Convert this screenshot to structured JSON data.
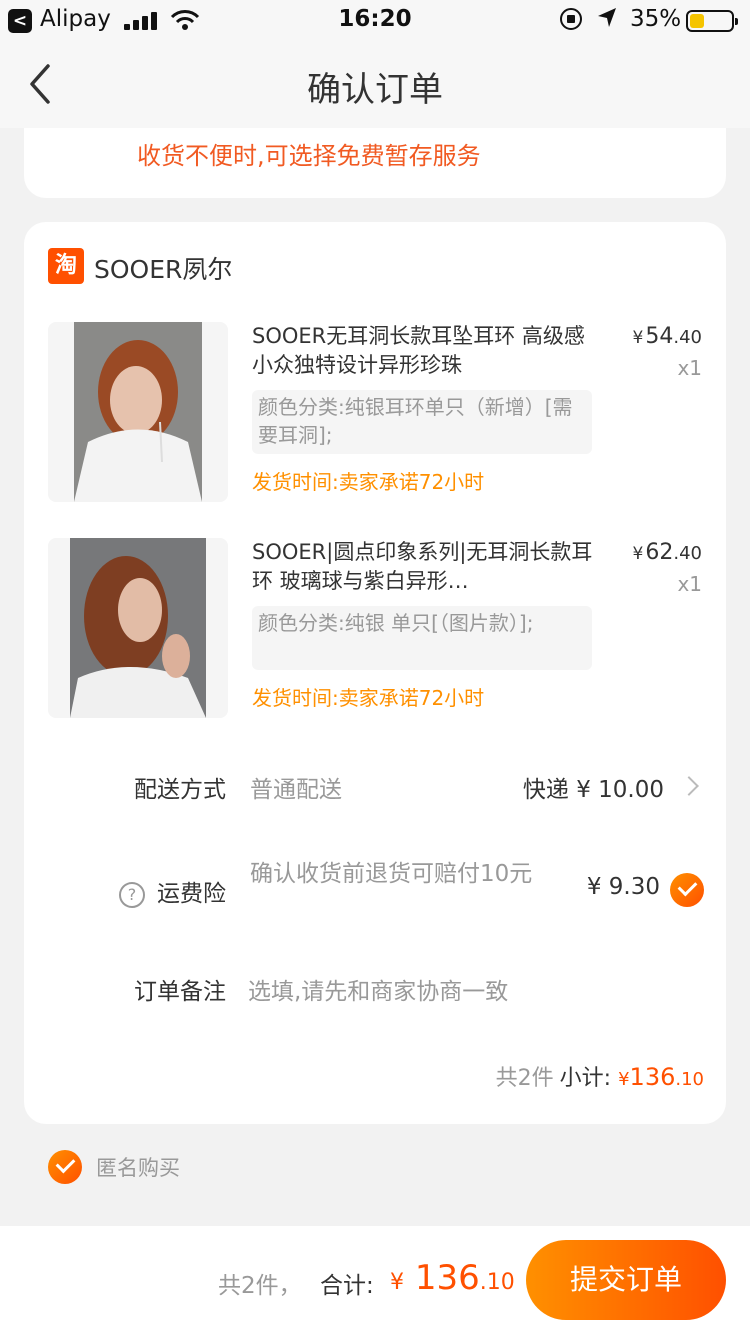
{
  "status_bar": {
    "back_app_glyph": "<",
    "carrier": "Alipay",
    "time": "16:20",
    "battery_percent": "35%",
    "battery_level": 0.35
  },
  "nav": {
    "title": "确认订单"
  },
  "address_card": {
    "notice": "收货不便时,可选择免费暂存服务"
  },
  "shop": {
    "logo_char": "淘",
    "name": "SOOER夙尔"
  },
  "items": [
    {
      "title": "SOOER无耳洞长款耳坠耳环 高级感小众独特设计异形珍珠",
      "sku": "颜色分类:纯银耳环单只（新增）[需要耳洞];",
      "ship": "发货时间:卖家承诺72小时",
      "price_currency": "¥",
      "price_int": "54",
      "price_dec": ".40",
      "qty": "x1"
    },
    {
      "title": "SOOER|圆点印象系列|无耳洞长款耳环 玻璃球与紫白异形…",
      "sku": "颜色分类:纯银 单只[（图片款）];",
      "ship": "发货时间:卖家承诺72小时",
      "price_currency": "¥",
      "price_int": "62",
      "price_dec": ".40",
      "qty": "x1"
    }
  ],
  "delivery": {
    "label": "配送方式",
    "value": "普通配送",
    "right": "快递 ¥ 10.00"
  },
  "insurance": {
    "help_glyph": "?",
    "label": "运费险",
    "value": "确认收货前退货可赔付10元",
    "price": "¥ 9.30",
    "checked": true
  },
  "remark": {
    "label": "订单备注",
    "placeholder": "选填,请先和商家协商一致"
  },
  "subtotal": {
    "count": "共2件",
    "label": "小计:",
    "currency": "¥",
    "int": "136",
    "dec": ".10"
  },
  "anonymous": {
    "label": "匿名购买",
    "checked": true
  },
  "bottom_bar": {
    "count": "共2件，",
    "total_label": "合计:",
    "currency": "¥",
    "total_int": "136",
    "total_dec": ".10",
    "submit": "提交订单"
  },
  "colors": {
    "accent": "#ff5000",
    "accent_light": "#ff9000",
    "notice": "#f15a22"
  }
}
